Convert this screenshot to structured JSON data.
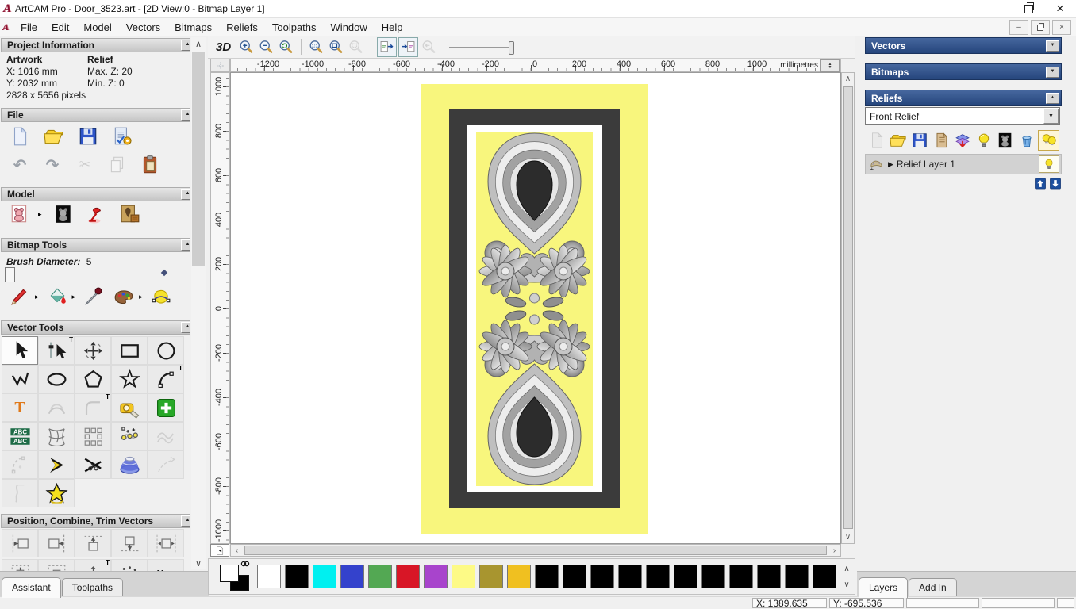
{
  "window": {
    "title": "ArtCAM Pro - Door_3523.art - [2D View:0 - Bitmap Layer 1]",
    "app_icon": "artcam-logo"
  },
  "menu": {
    "items": [
      "File",
      "Edit",
      "Model",
      "Vectors",
      "Bitmaps",
      "Reliefs",
      "Toolpaths",
      "Window",
      "Help"
    ]
  },
  "assistant": {
    "project_information": {
      "title": "Project Information",
      "artwork_heading": "Artwork",
      "relief_heading": "Relief",
      "artwork_x": "X: 1016 mm",
      "artwork_y": "Y: 2032 mm",
      "artwork_pixels": "2828 x 5656 pixels",
      "relief_max_z": "Max. Z: 20",
      "relief_min_z": "Min. Z: 0"
    },
    "file_section": {
      "title": "File",
      "row1": [
        {
          "name": "new-model"
        },
        {
          "name": "open-model"
        },
        {
          "name": "save-model"
        },
        {
          "name": "model-properties"
        }
      ],
      "row2": [
        {
          "name": "undo"
        },
        {
          "name": "redo"
        },
        {
          "name": "cut",
          "disabled": true
        },
        {
          "name": "copy",
          "disabled": true
        },
        {
          "name": "paste"
        }
      ]
    },
    "model_section": {
      "title": "Model",
      "icons": [
        {
          "name": "model-sketch",
          "flyout": true
        },
        {
          "name": "model-greyscale"
        },
        {
          "name": "lamp"
        },
        {
          "name": "texture"
        }
      ]
    },
    "bitmap_tools": {
      "title": "Bitmap Tools",
      "brush_label": "Brush Diameter:",
      "brush_value": "5",
      "icons": [
        {
          "name": "paint-pencil",
          "flyout": true
        },
        {
          "name": "flood-fill",
          "flyout": true
        },
        {
          "name": "colour-picker"
        },
        {
          "name": "palette",
          "flyout": true
        },
        {
          "name": "bitmap-to-vector"
        }
      ]
    },
    "vector_tools": {
      "title": "Vector Tools",
      "cells": [
        {
          "name": "select",
          "pressed": true
        },
        {
          "name": "node-edit",
          "pin": true
        },
        {
          "name": "transform"
        },
        {
          "name": "rectangle"
        },
        {
          "name": "circle-tool"
        },
        {
          "name": "polyline"
        },
        {
          "name": "ellipse-tool"
        },
        {
          "name": "polygon-tool"
        },
        {
          "name": "star-tool"
        },
        {
          "name": "arc-tool",
          "pin": true
        },
        {
          "name": "text-tool"
        },
        {
          "name": "offset-vectors",
          "disabled": true
        },
        {
          "name": "fillet-tool",
          "disabled": true,
          "pin": true
        },
        {
          "name": "measure"
        },
        {
          "name": "block-cross"
        },
        {
          "name": "text-abc"
        },
        {
          "name": "distort-grid"
        },
        {
          "name": "block-copy"
        },
        {
          "name": "nudge"
        },
        {
          "name": "wave",
          "disabled": true
        },
        {
          "name": "arc-fit",
          "disabled": true
        },
        {
          "name": "chevron"
        },
        {
          "name": "trim-scissors"
        },
        {
          "name": "extrude-dome"
        },
        {
          "name": "blend",
          "disabled": true
        },
        {
          "name": "profile",
          "disabled": true
        },
        {
          "name": "star-wizard"
        }
      ]
    },
    "position_section": {
      "title": "Position, Combine, Trim Vectors",
      "row1": [
        {
          "name": "align-left"
        },
        {
          "name": "align-right"
        },
        {
          "name": "align-top"
        },
        {
          "name": "align-bottom"
        },
        {
          "name": "align-centre"
        }
      ],
      "row2": [
        {
          "name": "centre-page"
        },
        {
          "name": "centre-page2"
        },
        {
          "name": "align-small",
          "pin": true
        },
        {
          "name": "scatter-dots"
        },
        {
          "name": "nesting-text"
        }
      ]
    },
    "tabs": [
      {
        "label": "Assistant",
        "active": true
      },
      {
        "label": "Toolpaths",
        "active": false
      }
    ]
  },
  "canvas": {
    "toolbar": {
      "view3d_label": "3D",
      "icons": [
        {
          "name": "zoom-in"
        },
        {
          "name": "zoom-out"
        },
        {
          "name": "zoom-last"
        },
        {
          "sep": true
        },
        {
          "name": "zoom-1to1"
        },
        {
          "name": "zoom-fit"
        },
        {
          "name": "zoom-object",
          "disabled": true
        },
        {
          "sep": true
        },
        {
          "name": "toggle-bitmap",
          "framed": true
        },
        {
          "name": "toggle-vector",
          "framed": true
        },
        {
          "name": "zoom-previous",
          "disabled": true
        }
      ]
    },
    "ruler": {
      "h_labels": [
        "-1200",
        "-1000",
        "-800",
        "-600",
        "-400",
        "-200",
        "0",
        "200",
        "400",
        "600",
        "800",
        "1000"
      ],
      "v_labels": [
        "1000",
        "800",
        "600",
        "400",
        "200",
        "0",
        "-200",
        "-400",
        "-600",
        "-800",
        "-1000"
      ],
      "units": "millimetres"
    },
    "design": {
      "background_color": "#f8f67d",
      "frame_color": "#3b3b3b",
      "panel_color": "#ffffff"
    }
  },
  "layers_panel": {
    "vectors": {
      "title": "Vectors"
    },
    "bitmaps": {
      "title": "Bitmaps"
    },
    "reliefs": {
      "title": "Reliefs",
      "combo_value": "Front Relief",
      "toolbar": [
        {
          "name": "new-relief",
          "disabled": true
        },
        {
          "name": "open-relief"
        },
        {
          "name": "save-relief"
        },
        {
          "name": "relief-paper"
        },
        {
          "name": "import-relief"
        },
        {
          "name": "relief-bulb"
        },
        {
          "name": "relief-greyscale"
        },
        {
          "name": "delete-relief"
        },
        {
          "name": "toggle-all-bulbs",
          "framed": true
        }
      ],
      "layer_name": "Relief Layer 1"
    },
    "tabs": [
      {
        "label": "Layers",
        "active": true
      },
      {
        "label": "Add In",
        "active": false
      }
    ]
  },
  "palette": {
    "colors": [
      "#ffffff",
      "#000000",
      "#00f0f0",
      "#3442cc",
      "#53a853",
      "#d81626",
      "#a844cc",
      "#fdfa86",
      "#a8952f",
      "#f0c020",
      "#000000",
      "#000000",
      "#000000",
      "#000000",
      "#000000",
      "#000000",
      "#000000",
      "#000000",
      "#000000",
      "#000000",
      "#000000"
    ]
  },
  "status_bar": {
    "x_value": "X: 1389.635",
    "y_value": "Y: -695.536"
  }
}
